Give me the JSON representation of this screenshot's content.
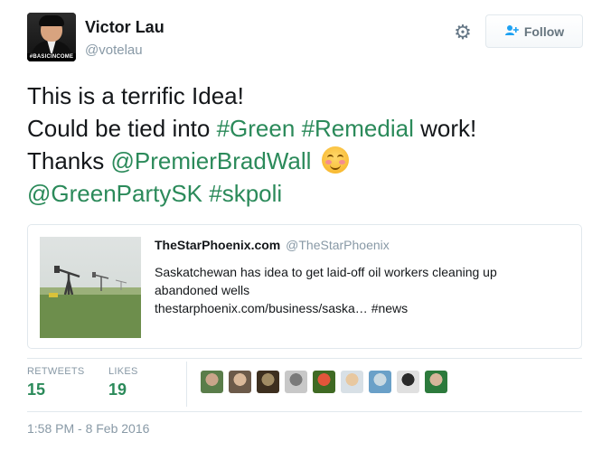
{
  "author": {
    "name": "Victor Lau",
    "handle": "@votelau",
    "avatar_tag": "#BASICINCOME",
    "avatar_icon": "profile-photo"
  },
  "actions": {
    "settings_icon": "gear-icon",
    "follow_label": "Follow",
    "follow_icon": "add-user-icon"
  },
  "tweet": {
    "line1": "This is a terrific Idea!",
    "line2_pre": "Could be tied into ",
    "hashtag_green": "#Green",
    "hashtag_remedial": "#Remedial",
    "line2_post": " work!",
    "line3_pre": "Thanks ",
    "mention_premier": "@PremierBradWall",
    "emoji": "smiling-face-icon",
    "mention_greenparty": "@GreenPartySK",
    "hashtag_skpoli": "#skpoli"
  },
  "quoted": {
    "author_name": "TheStarPhoenix.com",
    "author_handle": "@TheStarPhoenix",
    "text_line1": "Saskatchewan has idea to get laid-off oil workers cleaning up",
    "text_line2": "abandoned wells",
    "link": "thestarphoenix.com/business/saska…",
    "hashtag": "#news"
  },
  "stats": {
    "retweets_label": "RETWEETS",
    "retweets_count": "15",
    "likes_label": "LIKES",
    "likes_count": "19"
  },
  "likers": [
    {
      "colors": [
        "#5a7d4a",
        "#c9a58a"
      ]
    },
    {
      "colors": [
        "#6c5a4a",
        "#d9b89a"
      ]
    },
    {
      "colors": [
        "#3d2f1f",
        "#a08b63"
      ]
    },
    {
      "colors": [
        "#c8c8c8",
        "#7a7a7a"
      ]
    },
    {
      "colors": [
        "#3f6a23",
        "#e2553a"
      ]
    },
    {
      "colors": [
        "#d8e0e6",
        "#e8c8a0"
      ]
    },
    {
      "colors": [
        "#6aa0c8",
        "#c9d9e2"
      ]
    },
    {
      "colors": [
        "#e0e0e0",
        "#2a2a2a"
      ]
    },
    {
      "colors": [
        "#2c7a3c",
        "#d6b59a"
      ]
    }
  ],
  "timestamp": "1:58 PM - 8 Feb 2016",
  "colors": {
    "link": "#2b8a5a",
    "secondary_text": "#8899a6",
    "border": "#e1e8ed"
  }
}
